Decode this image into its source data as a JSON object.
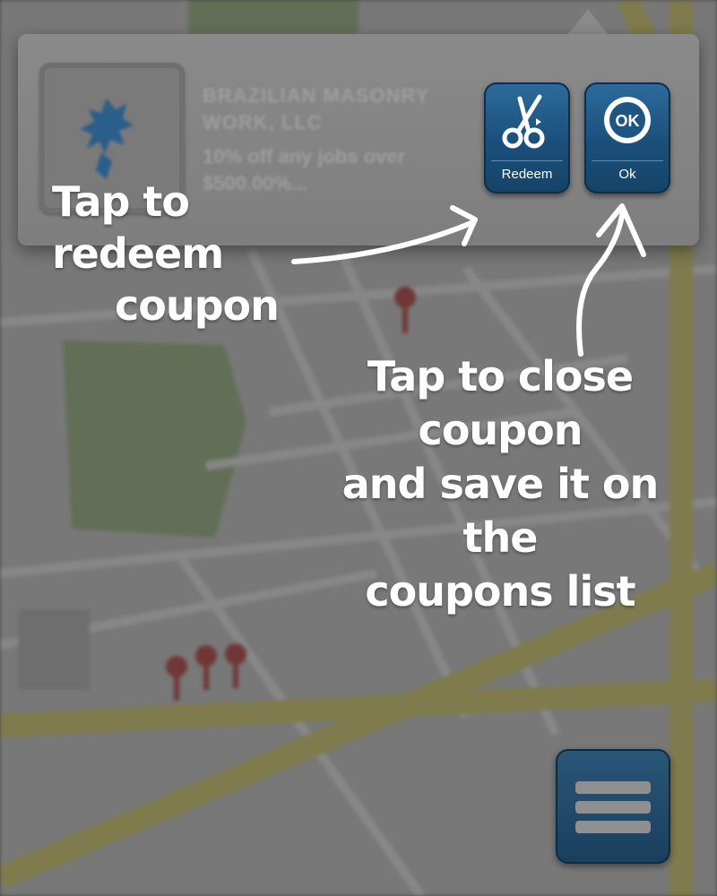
{
  "coupon": {
    "merchant": "BRAZILIAN MASONRY WORK, LLC",
    "offer": "10% off any jobs over $500.00%...",
    "redeem_label": "Redeem",
    "ok_label": "Ok",
    "ok_badge_text": "OK"
  },
  "annotations": {
    "redeem_line1": "Tap to redeem",
    "redeem_line2": "coupon",
    "ok_line1": "Tap to close coupon",
    "ok_line2": "and save it on the",
    "ok_line3": "coupons list"
  },
  "colors": {
    "button_blue": "#1a4f7a",
    "overlay": "#6f6f6f",
    "pin_red": "#b23a3a",
    "road_yellow": "#bdb96a",
    "park_green": "#7fa36a"
  },
  "icons": {
    "redeem": "scissors-icon",
    "ok": "ok-badge-icon",
    "menu": "menu-icon"
  }
}
